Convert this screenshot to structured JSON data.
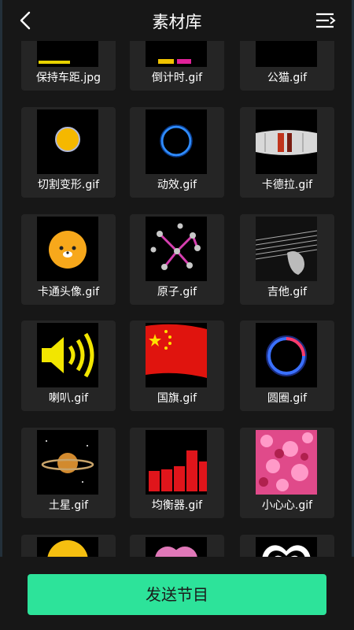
{
  "header": {
    "title": "素材库",
    "back_icon": "chevron-left-icon",
    "menu_icon": "list-menu-icon"
  },
  "items": [
    {
      "label": "保持车距.jpg"
    },
    {
      "label": "倒计时.gif"
    },
    {
      "label": "公猫.gif"
    },
    {
      "label": "切割变形.gif"
    },
    {
      "label": "动效.gif"
    },
    {
      "label": "卡德拉.gif"
    },
    {
      "label": "卡通头像.gif"
    },
    {
      "label": "原子.gif"
    },
    {
      "label": "吉他.gif"
    },
    {
      "label": "喇叭.gif"
    },
    {
      "label": "国旗.gif"
    },
    {
      "label": "圆圈.gif"
    },
    {
      "label": "土星.gif"
    },
    {
      "label": "均衡器.gif"
    },
    {
      "label": "小心心.gif"
    },
    {
      "label": ""
    },
    {
      "label": ""
    },
    {
      "label": ""
    }
  ],
  "footer": {
    "send_label": "发送节目"
  },
  "colors": {
    "background": "#171717",
    "card": "#252525",
    "accent": "#2de39a"
  }
}
